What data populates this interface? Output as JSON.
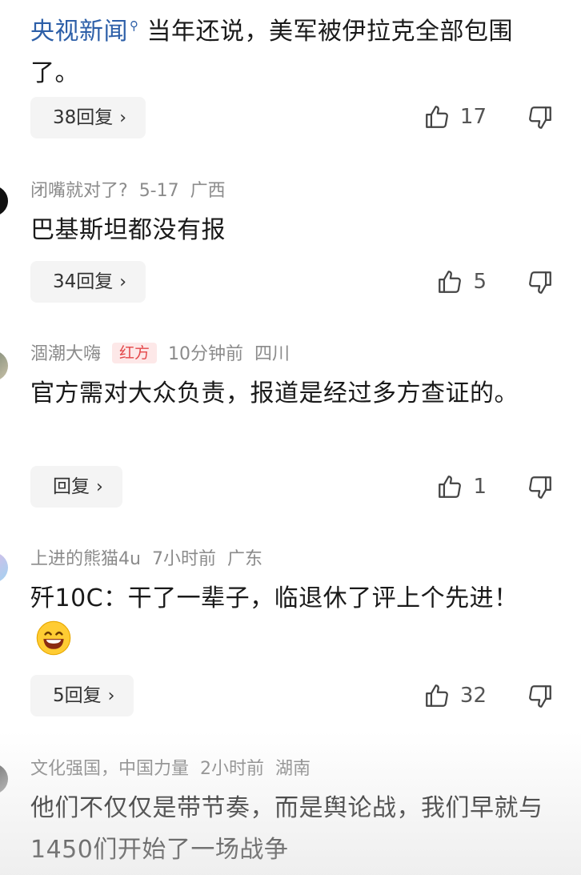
{
  "comments": [
    {
      "author": "央视新闻",
      "verified_icon": "search-icon",
      "time": "",
      "location": "",
      "text": "当年还说，美军被伊拉克全部包围了。",
      "replies_label": "38回复",
      "likes": "17"
    },
    {
      "author": "闭嘴就对了?",
      "time": "5-17",
      "location": "广西",
      "text": "巴基斯坦都没有报",
      "replies_label": "34回复",
      "likes": "5"
    },
    {
      "author": "涸潮大嗨",
      "badge": "红方",
      "time": "10分钟前",
      "location": "四川",
      "text": "官方需对大众负责，报道是经过多方查证的。",
      "replies_label": "回复",
      "likes": "1"
    },
    {
      "author": "上进的熊猫4u",
      "time": "7小时前",
      "location": "广东",
      "text": "歼10C：干了一辈子，临退休了评上个先进！",
      "emoji": "grinning-face-emoji",
      "replies_label": "5回复",
      "likes": "32"
    },
    {
      "author": "文化强国，中国力量",
      "time": "2小时前",
      "location": "湖南",
      "text": "他们不仅仅是带节奏，而是舆论战，我们早就与1450们开始了一场战争"
    }
  ],
  "icons": {
    "like": "thumbs-up-icon",
    "dislike": "thumbs-down-icon",
    "chevron": "chevron-right-icon"
  },
  "colors": {
    "author_link": "#2d5fa8",
    "meta": "#8b8b8b",
    "badge_bg": "#fde8e8",
    "badge_text": "#e4484a"
  }
}
